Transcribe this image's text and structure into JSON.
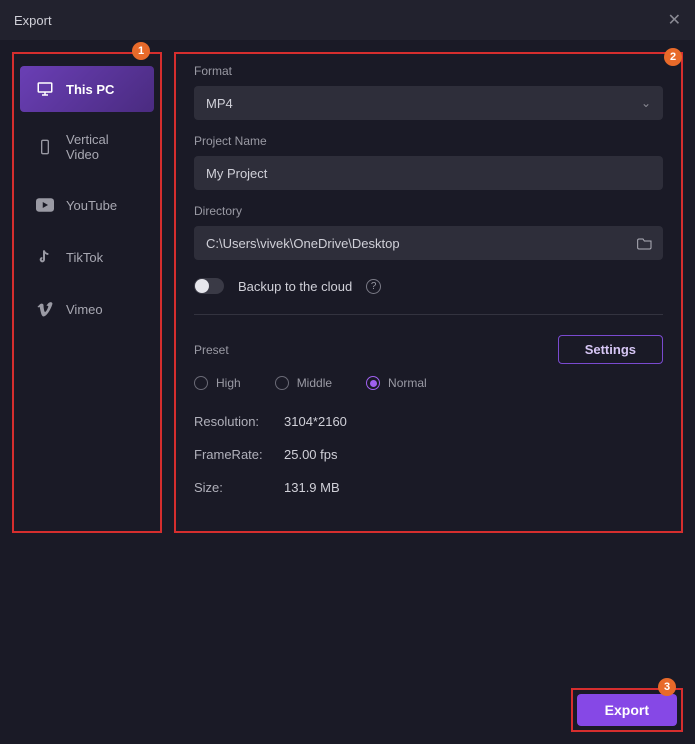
{
  "title": "Export",
  "badges": {
    "b1": "1",
    "b2": "2",
    "b3": "3"
  },
  "sidebar": {
    "items": [
      {
        "label": "This PC"
      },
      {
        "label": "Vertical Video"
      },
      {
        "label": "YouTube"
      },
      {
        "label": "TikTok"
      },
      {
        "label": "Vimeo"
      }
    ]
  },
  "form": {
    "format_label": "Format",
    "format_value": "MP4",
    "project_name_label": "Project Name",
    "project_name_value": "My Project",
    "directory_label": "Directory",
    "directory_value": "C:\\Users\\vivek\\OneDrive\\Desktop",
    "backup_label": "Backup to the cloud"
  },
  "preset": {
    "label": "Preset",
    "settings_btn": "Settings",
    "options": [
      {
        "label": "High"
      },
      {
        "label": "Middle"
      },
      {
        "label": "Normal"
      }
    ]
  },
  "specs": {
    "resolution_label": "Resolution:",
    "resolution_value": "3104*2160",
    "framerate_label": "FrameRate:",
    "framerate_value": "25.00 fps",
    "size_label": "Size:",
    "size_value": "131.9 MB"
  },
  "export_btn": "Export"
}
